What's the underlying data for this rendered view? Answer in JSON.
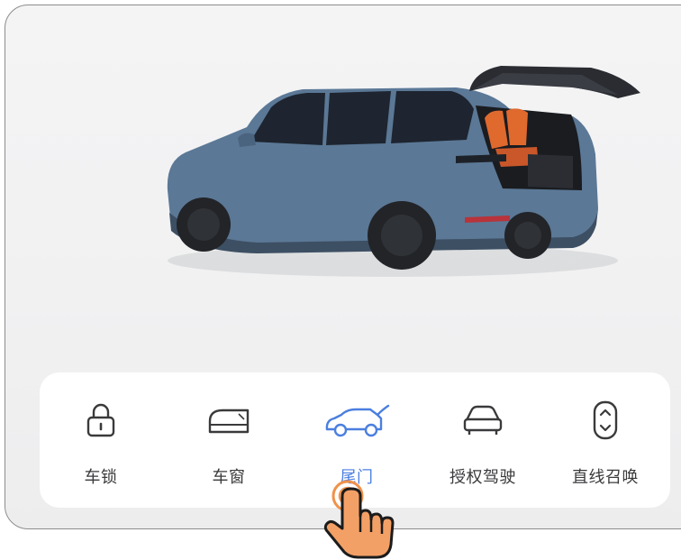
{
  "toolbar": {
    "items": [
      {
        "label": "车锁",
        "icon": "lock-icon",
        "active": false
      },
      {
        "label": "车窗",
        "icon": "window-icon",
        "active": false
      },
      {
        "label": "尾门",
        "icon": "tailgate-icon",
        "active": true
      },
      {
        "label": "授权驾驶",
        "icon": "authorized-drive-icon",
        "active": false
      },
      {
        "label": "直线召唤",
        "icon": "straight-summon-icon",
        "active": false
      }
    ]
  },
  "colors": {
    "accent": "#4b7fe0",
    "car_body": "#5b7896",
    "seat": "#e0692e",
    "hand": "#f0914a"
  }
}
